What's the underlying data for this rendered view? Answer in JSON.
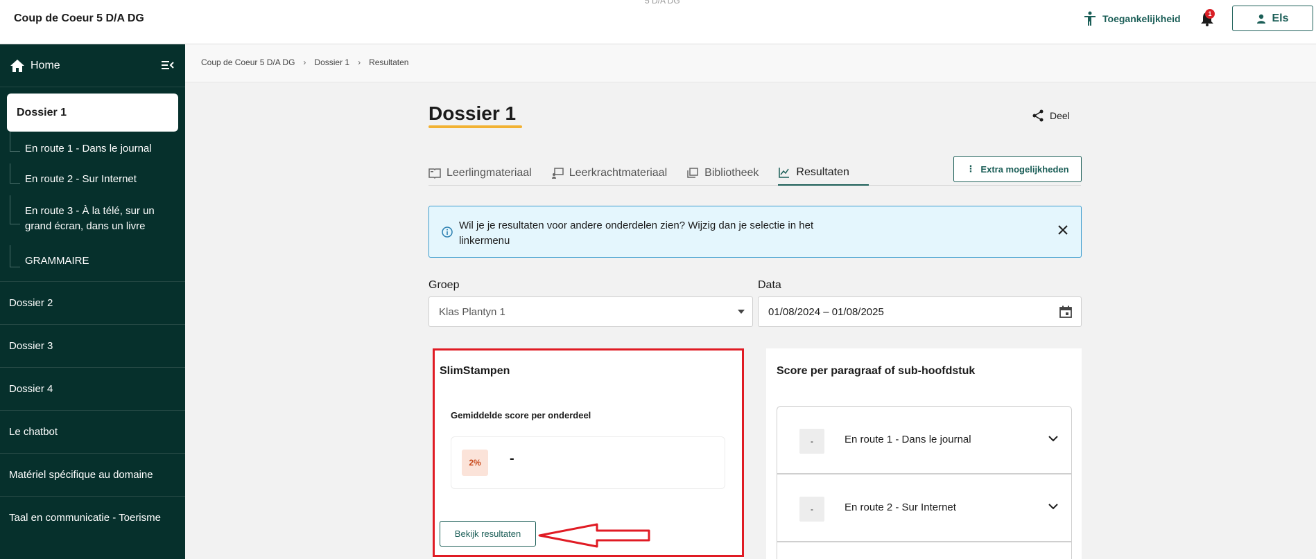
{
  "header": {
    "brand": "Coup de Coeur 5 D/A DG",
    "center_subtitle": "5 D/A DG",
    "accessibility": "Toegankelijkheid",
    "notification_count": "1",
    "user": "Els"
  },
  "sidebar": {
    "home": "Home",
    "active": "Dossier 1",
    "sub_items": [
      "En route 1 - Dans le journal",
      "En route 2 - Sur Internet",
      "En route 3 - À la télé, sur un grand écran, dans un livre",
      "GRAMMAIRE"
    ],
    "items": [
      "Dossier 2",
      "Dossier 3",
      "Dossier 4",
      "Le chatbot",
      "Matériel spécifique au domaine",
      "Taal en communicatie - Toerisme"
    ]
  },
  "breadcrumb": [
    "Coup de Coeur 5 D/A DG",
    "Dossier 1",
    "Resultaten"
  ],
  "main": {
    "title": "Dossier 1",
    "share": "Deel",
    "tabs": [
      "Leerlingmateriaal",
      "Leerkrachtmateriaal",
      "Bibliotheek",
      "Resultaten"
    ],
    "extra": "Extra mogelijkheden",
    "info": "Wil je je resultaten voor andere onderdelen zien? Wijzig dan je selectie in het linkermenu",
    "group_label": "Groep",
    "group_value": "Klas Plantyn 1",
    "date_label": "Data",
    "date_value": "01/08/2024 – 01/08/2025"
  },
  "slimstampen": {
    "title": "SlimStampen",
    "subtitle": "Gemiddelde score per onderdeel",
    "percent": "2%",
    "value": "-",
    "button": "Bekijk resultaten"
  },
  "paragraph_scores": {
    "title": "Score per paragraaf of sub-hoofdstuk",
    "rows": [
      {
        "badge": "-",
        "label": "En route 1 - Dans le journal"
      },
      {
        "badge": "-",
        "label": "En route 2 - Sur Internet"
      }
    ]
  },
  "colors": {
    "accent": "#1b5e57",
    "sidebar": "#06302c",
    "highlight": "#e01b24",
    "title_underline": "#f2b233"
  }
}
